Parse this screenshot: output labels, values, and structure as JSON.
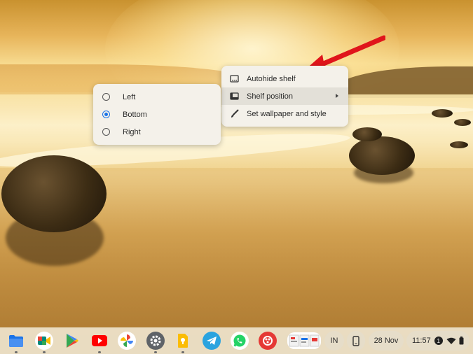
{
  "context_menu": {
    "items": [
      {
        "label": "Autohide shelf",
        "icon": "autohide-icon"
      },
      {
        "label": "Shelf position",
        "icon": "shelf-position-icon",
        "has_submenu": true,
        "highlighted": true
      },
      {
        "label": "Set wallpaper and style",
        "icon": "paintbrush-icon"
      }
    ]
  },
  "submenu": {
    "items": [
      {
        "label": "Left",
        "selected": false
      },
      {
        "label": "Bottom",
        "selected": true
      },
      {
        "label": "Right",
        "selected": false
      }
    ]
  },
  "shelf": {
    "apps": [
      {
        "name": "files-icon",
        "color": "#1a73e8"
      },
      {
        "name": "google-meet-icon",
        "color": "#00897b"
      },
      {
        "name": "play-store-icon",
        "color": "#34a853"
      },
      {
        "name": "youtube-icon",
        "color": "#ff0000"
      },
      {
        "name": "google-photos-icon",
        "color": "#fbbc04"
      },
      {
        "name": "settings-icon",
        "color": "#5f6368"
      },
      {
        "name": "keep-icon",
        "color": "#fbbc04"
      },
      {
        "name": "telegram-icon",
        "color": "#2aa3df"
      },
      {
        "name": "whatsapp-icon",
        "color": "#25d366"
      },
      {
        "name": "color-app-icon",
        "color": "#e53935"
      }
    ],
    "tray": {
      "ime": "IN",
      "date": "28 Nov",
      "time": "11:57",
      "notification_count": "1"
    }
  },
  "colors": {
    "accent": "#1a73e8",
    "arrow": "#e0151b",
    "menu_bg": "#f4f1ea"
  }
}
